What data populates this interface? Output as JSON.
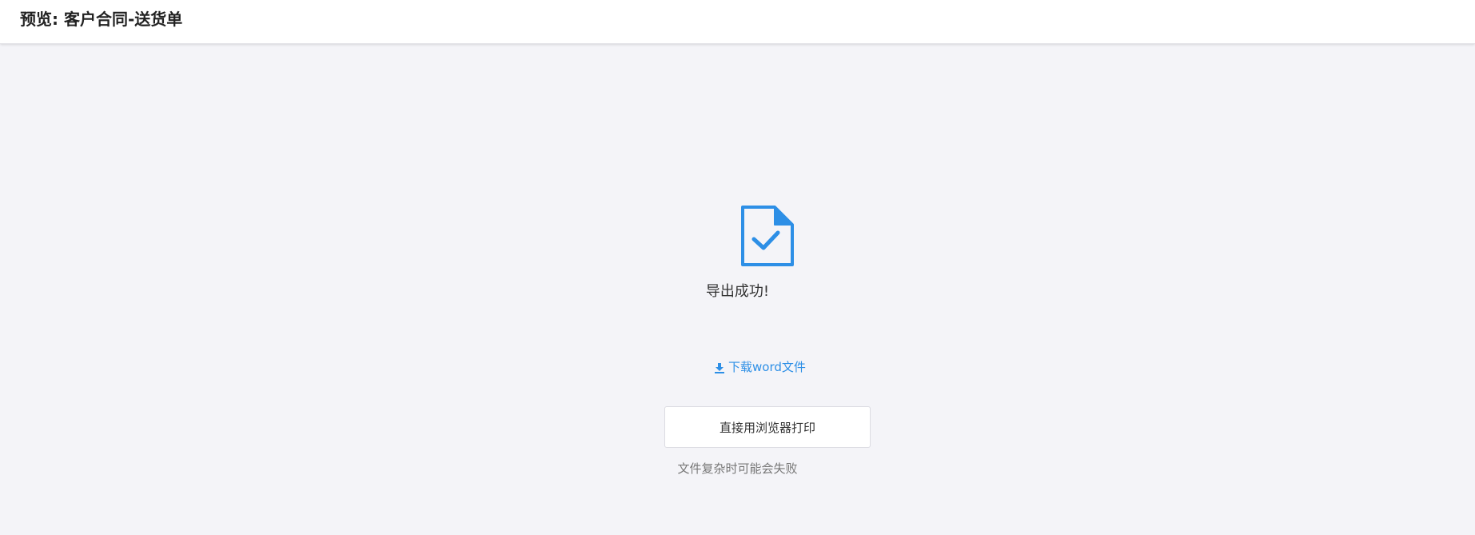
{
  "header": {
    "title": "预览: 客户合同-送货单"
  },
  "icons": {
    "document": "document-check-icon",
    "download": "download-icon"
  },
  "colors": {
    "accent": "#2d8fe6",
    "background": "#f4f4f8",
    "header_bg": "#ffffff"
  },
  "main": {
    "success_message": "导出成功!",
    "download_label": "下载word文件",
    "print_button_label": "直接用浏览器打印",
    "hint": "文件复杂时可能会失败"
  }
}
